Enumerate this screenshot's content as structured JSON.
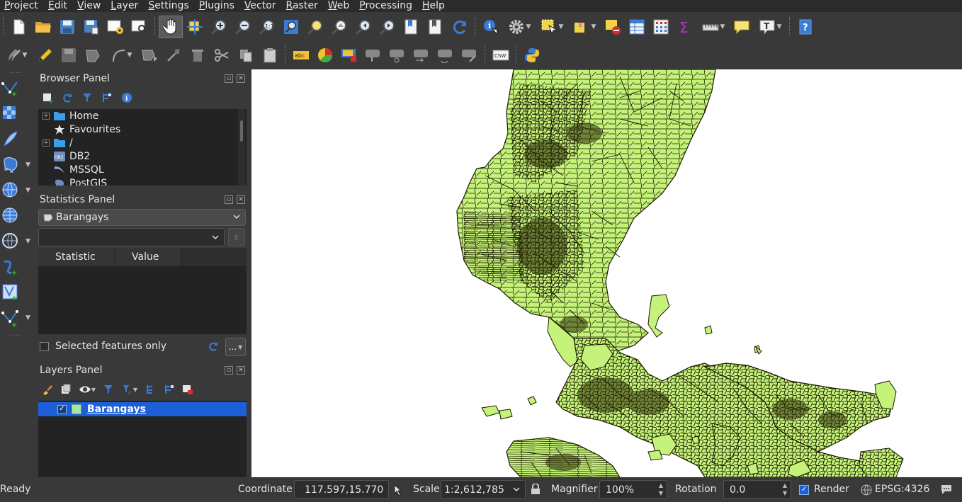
{
  "menu": [
    "Project",
    "Edit",
    "View",
    "Layer",
    "Settings",
    "Plugins",
    "Vector",
    "Raster",
    "Web",
    "Processing",
    "Help"
  ],
  "toolbar_top": {
    "items": [
      "new-project",
      "open-project",
      "save-project",
      "save-as",
      "new-print-layout",
      "layout-manager",
      "pan-map",
      "pan-to-selection",
      "zoom-in",
      "zoom-out",
      "zoom-native",
      "zoom-full",
      "zoom-to-selection",
      "zoom-to-layer",
      "zoom-last",
      "zoom-next",
      "new-bookmark",
      "show-bookmarks",
      "refresh",
      "identify",
      "run-action",
      "select-features",
      "deselect",
      "open-attribute-table",
      "open-field-calculator",
      "statistical-summary",
      "measure",
      "map-tips",
      "text-annotation",
      "help"
    ]
  },
  "toolbar_second": {
    "csw_label": "CSW",
    "abc_label": "abc"
  },
  "browser_panel": {
    "title": "Browser Panel",
    "items": [
      {
        "label": "Home",
        "icon": "folder-icon",
        "expandable": true
      },
      {
        "label": "Favourites",
        "icon": "star-icon",
        "expandable": false
      },
      {
        "label": "/",
        "icon": "folder-icon",
        "expandable": true
      },
      {
        "label": "DB2",
        "icon": "db2-icon",
        "expandable": false
      },
      {
        "label": "MSSQL",
        "icon": "mssql-icon",
        "expandable": false
      },
      {
        "label": "PostGIS",
        "icon": "postgis-icon",
        "expandable": false
      }
    ]
  },
  "statistics_panel": {
    "title": "Statistics Panel",
    "layer": "Barangays",
    "field": "",
    "columns": [
      "Statistic",
      "Value"
    ],
    "selected_only_label": "Selected features only",
    "more_button": "..."
  },
  "layers_panel": {
    "title": "Layers Panel",
    "layers": [
      {
        "name": "Barangays",
        "visible": true,
        "color": "#a8e6a0"
      }
    ]
  },
  "map": {
    "fill_color": "#c4f27a",
    "stroke_color": "#1a1a00"
  },
  "status": {
    "message": "Ready",
    "coordinate_label": "Coordinate",
    "coordinate": "117.597,15.770",
    "scale_label": "Scale",
    "scale": "1:2,612,785",
    "magnifier_label": "Magnifier",
    "magnifier": "100%",
    "rotation_label": "Rotation",
    "rotation": "0.0",
    "render_label": "Render",
    "render_checked": true,
    "crs": "EPSG:4326"
  }
}
